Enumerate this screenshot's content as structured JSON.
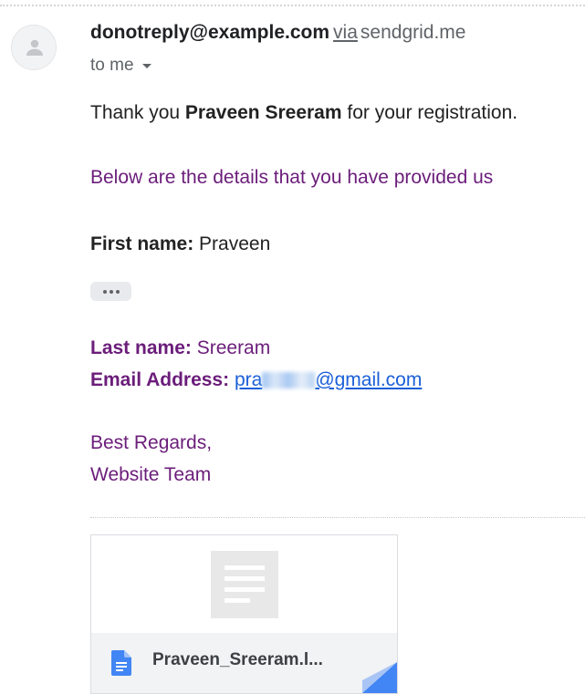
{
  "sender": {
    "email": "donotreply@example.com",
    "via_label": "via",
    "via_domain": "sendgrid.me"
  },
  "recipient": {
    "label": "to me"
  },
  "body": {
    "greeting_prefix": "Thank you ",
    "name": "Praveen Sreeram",
    "greeting_suffix": " for your registration.",
    "intro": "Below are the details that you have provided us",
    "first_name_label": "First name:",
    "first_name_value": " Praveen",
    "last_name_label": "Last name:",
    "last_name_value": " Sreeram",
    "email_label": "Email Address:",
    "email_prefix": "pra",
    "email_suffix": "@gmail.com",
    "regards_line1": "Best Regards,",
    "regards_line2": "Website Team"
  },
  "attachment": {
    "name": "Praveen_Sreeram.l..."
  },
  "icons": {
    "avatar": "person-icon",
    "dropdown": "caret-down-icon",
    "trimmed": "ellipsis-icon",
    "document": "google-doc-icon"
  },
  "colors": {
    "purple_text": "#6b1d7a",
    "link": "#1a5fd8",
    "doc_blue": "#4285f4"
  }
}
